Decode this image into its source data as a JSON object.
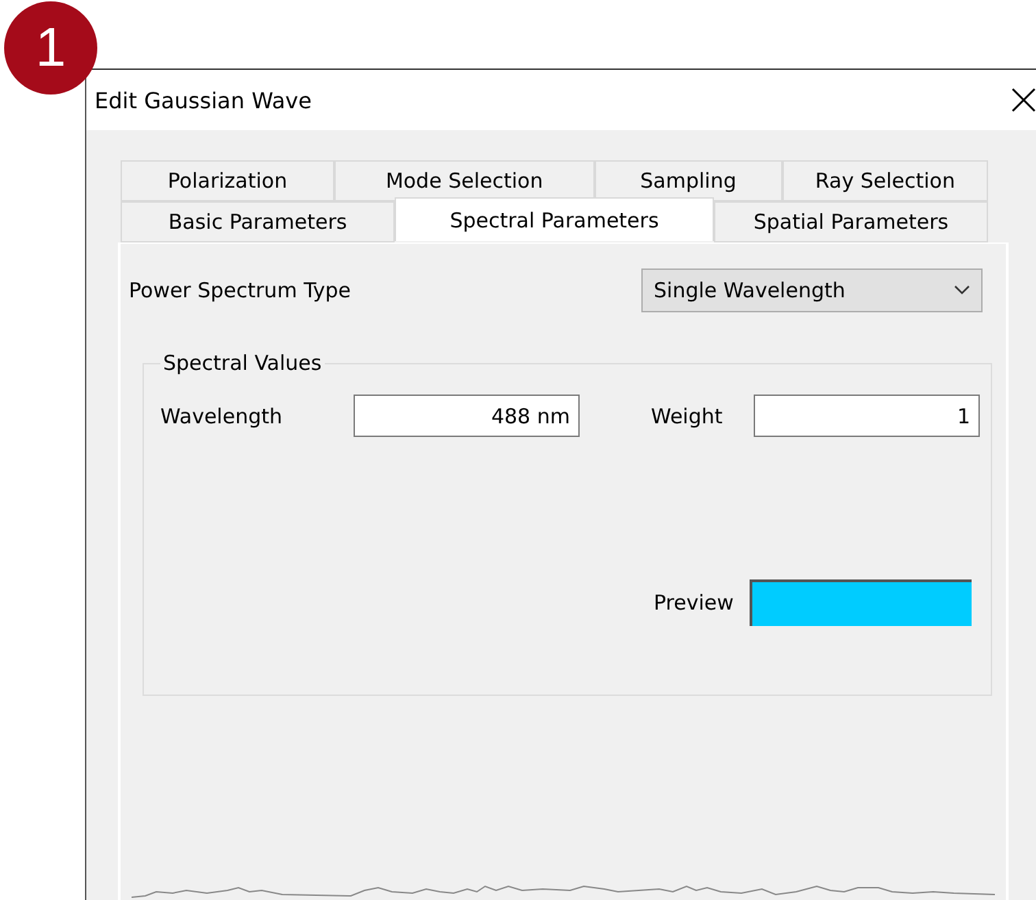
{
  "badge": "1",
  "window": {
    "title": "Edit Gaussian Wave"
  },
  "tab_rows": [
    {
      "tabs": [
        {
          "label": "Polarization",
          "selected": false
        },
        {
          "label": "Mode Selection",
          "selected": false
        },
        {
          "label": "Sampling",
          "selected": false
        },
        {
          "label": "Ray Selection",
          "selected": false
        }
      ]
    },
    {
      "tabs": [
        {
          "label": "Basic Parameters",
          "selected": false
        },
        {
          "label": "Spectral Parameters",
          "selected": true
        },
        {
          "label": "Spatial Parameters",
          "selected": false
        }
      ]
    }
  ],
  "power_spectrum_type": {
    "label": "Power Spectrum Type",
    "value": "Single Wavelength"
  },
  "spectral_values": {
    "title": "Spectral Values",
    "wavelength": {
      "label": "Wavelength",
      "value": "488 nm"
    },
    "weight": {
      "label": "Weight",
      "value": "1"
    },
    "preview": {
      "label": "Preview",
      "color": "#00ccff"
    }
  }
}
